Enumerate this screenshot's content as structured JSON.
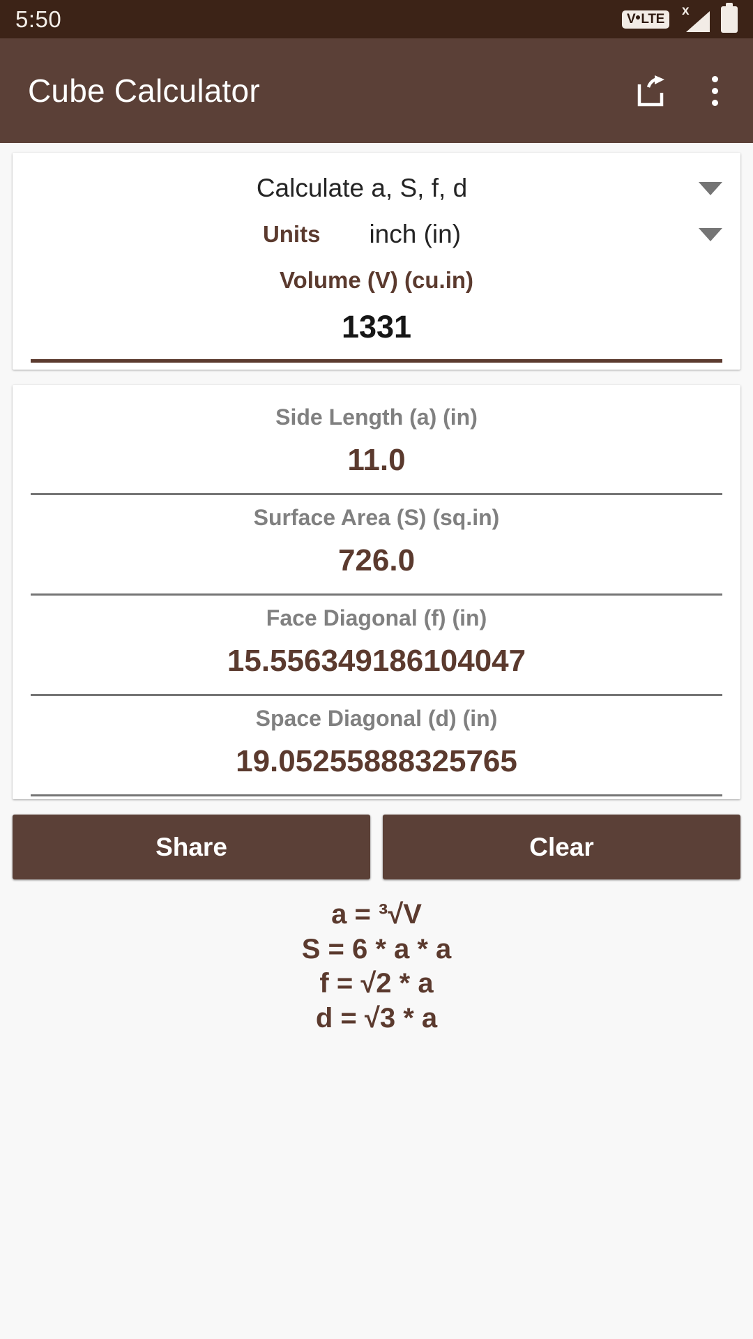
{
  "status_bar": {
    "time": "5:50",
    "volte_label_start": "V",
    "volte_label_end": "LTE",
    "signal_x": "x",
    "icons": [
      "volte-icon",
      "signal-icon",
      "battery-icon"
    ]
  },
  "app_bar": {
    "title": "Cube Calculator",
    "share_icon": "share-icon",
    "overflow_icon": "overflow-menu-icon"
  },
  "input_card": {
    "mode_spinner": {
      "value": "Calculate a, S, f, d",
      "caret_icon": "chevron-down-icon"
    },
    "units_spinner": {
      "label": "Units",
      "value": "inch (in)",
      "caret_icon": "chevron-down-icon"
    },
    "volume_field": {
      "label": "Volume (V) (cu.in)",
      "value": "1331",
      "placeholder": "Volume (V) (cu.in)"
    }
  },
  "results_card": {
    "rows": [
      {
        "label": "Side Length (a) (in)",
        "value": "11.0"
      },
      {
        "label": "Surface Area (S) (sq.in)",
        "value": "726.0"
      },
      {
        "label": "Face Diagonal (f) (in)",
        "value": "15.556349186104047"
      },
      {
        "label": "Space Diagonal (d) (in)",
        "value": "19.05255888325765"
      }
    ]
  },
  "buttons": {
    "share": "Share",
    "clear": "Clear"
  },
  "formulas": [
    "a = ³√V",
    "S = 6 * a * a",
    "f = √2 * a",
    "d = √3 * a"
  ],
  "colors": {
    "status_bar_bg": "#3c2317",
    "app_bar_bg": "#5b4037",
    "accent_brown": "#5b3a2e",
    "page_bg": "#f8f8f8",
    "label_gray": "#808080",
    "card_bg": "#ffffff"
  }
}
